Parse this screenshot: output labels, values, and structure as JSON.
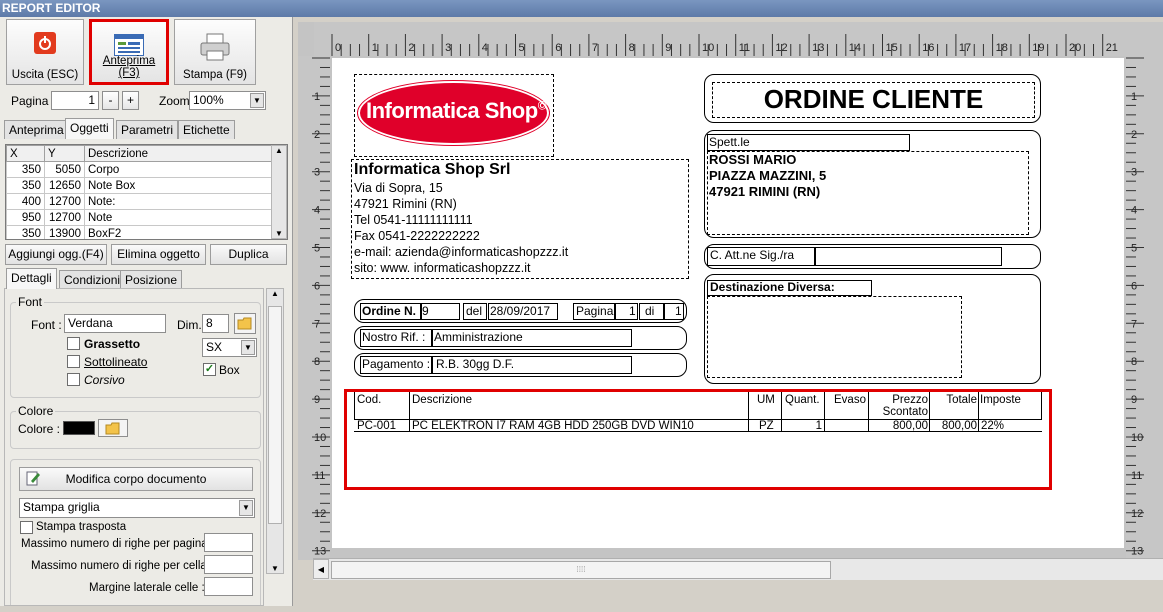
{
  "window": {
    "title": "REPORT EDITOR"
  },
  "toolbar": {
    "exit": "Uscita (ESC)",
    "preview": "Anteprima (F3)",
    "print": "Stampa (F9)"
  },
  "pager": {
    "page_label": "Pagina",
    "page_value": "1",
    "minus": "-",
    "plus": "+",
    "zoom_label": "Zoom",
    "zoom_value": "100%"
  },
  "tabs": [
    "Anteprima",
    "Oggetti",
    "Parametri",
    "Etichette"
  ],
  "objects_table": {
    "headers": [
      "X",
      "Y",
      "Descrizione"
    ],
    "rows": [
      [
        "350",
        "5050",
        "Corpo"
      ],
      [
        "350",
        "12650",
        "Note Box"
      ],
      [
        "400",
        "12700",
        "Note:"
      ],
      [
        "950",
        "12700",
        "Note"
      ],
      [
        "350",
        "13900",
        "BoxF2"
      ]
    ]
  },
  "object_buttons": {
    "add": "Aggiungi ogg.(F4)",
    "delete": "Elimina oggetto",
    "duplicate": "Duplica"
  },
  "detail_tabs": [
    "Dettagli",
    "Condizioni",
    "Posizione"
  ],
  "font": {
    "group": "Font",
    "label": "Font :",
    "value": "Verdana",
    "dim_label": "Dim.",
    "dim_value": "8",
    "bold": "Grassetto",
    "underline": "Sottolineato",
    "italic": "Corsivo",
    "align": "SX",
    "box": "Box"
  },
  "color": {
    "group": "Colore",
    "label": "Colore :",
    "value": "#000000"
  },
  "body": {
    "edit_btn": "Modifica corpo documento",
    "grid_select": "Stampa griglia",
    "transpose": "Stampa trasposta",
    "max_rows_page": "Massimo numero di righe per pagina :",
    "max_rows_cell": "Massimo numero di righe per cella :",
    "margin": "Margine laterale celle :"
  },
  "ruler": {
    "h": [
      "0",
      "1",
      "2",
      "3",
      "4",
      "5",
      "6",
      "7",
      "8",
      "9",
      "10",
      "11",
      "12",
      "13",
      "14",
      "15",
      "16",
      "17",
      "18",
      "19",
      "20",
      "21"
    ],
    "v": [
      "1",
      "2",
      "3",
      "4",
      "5",
      "6",
      "7",
      "8",
      "9",
      "10",
      "11",
      "12",
      "13"
    ]
  },
  "report": {
    "logo": "Informatica Shop",
    "logo_mark": "©",
    "company": {
      "name": "Informatica Shop Srl",
      "lines": [
        "Via di Sopra, 15",
        "47921 Rimini (RN)",
        "Tel 0541-11111111111",
        "Fax 0541-2222222222",
        "e-mail: azienda@informaticashopzzz.it",
        "sito: www. informaticashopzzz.it"
      ]
    },
    "title": "ORDINE CLIENTE",
    "spett": "Spett.le",
    "customer": [
      "ROSSI MARIO",
      "PIAZZA MAZZINI, 5",
      "47921 RIMINI (RN)"
    ],
    "att": "C. Att.ne Sig./ra",
    "dest": "Destinazione Diversa:",
    "order": {
      "label": "Ordine N.",
      "num": "9",
      "del": "del",
      "date": "28/09/2017",
      "page_label": "Pagina",
      "page": "1",
      "di": "di",
      "pages": "1"
    },
    "ref": {
      "label": "Nostro Rif. :",
      "value": "Amministrazione"
    },
    "payment": {
      "label": "Pagamento :",
      "value": "R.B. 30gg D.F."
    },
    "table": {
      "headers": [
        "Cod.",
        "Descrizione",
        "UM",
        "Quant.",
        "Evaso",
        "Prezzo Scontato",
        "Totale",
        "Imposte"
      ],
      "rows": [
        [
          "PC-001",
          "PC ELEKTRON I7 RAM 4GB HDD 250GB DVD WIN10",
          "PZ",
          "1",
          "",
          "800,00",
          "800,00",
          "22%"
        ]
      ]
    }
  },
  "colors": {
    "highlight": "#e00000",
    "logo_bg": "#e0002a"
  }
}
